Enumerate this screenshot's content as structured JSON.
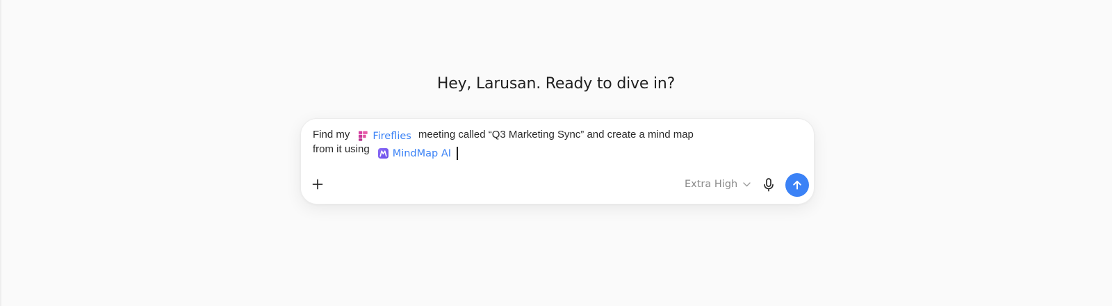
{
  "greeting": "Hey, Larusan. Ready to dive in?",
  "composer": {
    "prompt": {
      "part1": "Find my",
      "mention1": {
        "label": "Fireflies",
        "icon": "fireflies-icon",
        "color": "#d63fa0"
      },
      "part2": "meeting called “Q3 Marketing Sync” and create a mind map",
      "part3": "from it using",
      "mention2": {
        "label": "MindMap AI",
        "icon": "mindmap-ai-icon",
        "color": "#7c5cf5"
      }
    },
    "mode_select": {
      "value": "Extra High"
    },
    "icons": {
      "add": "plus-icon",
      "mic": "microphone-icon",
      "send": "arrow-up-icon"
    },
    "colors": {
      "accent": "#3b82f6",
      "mention_text": "#3b82f6"
    }
  }
}
